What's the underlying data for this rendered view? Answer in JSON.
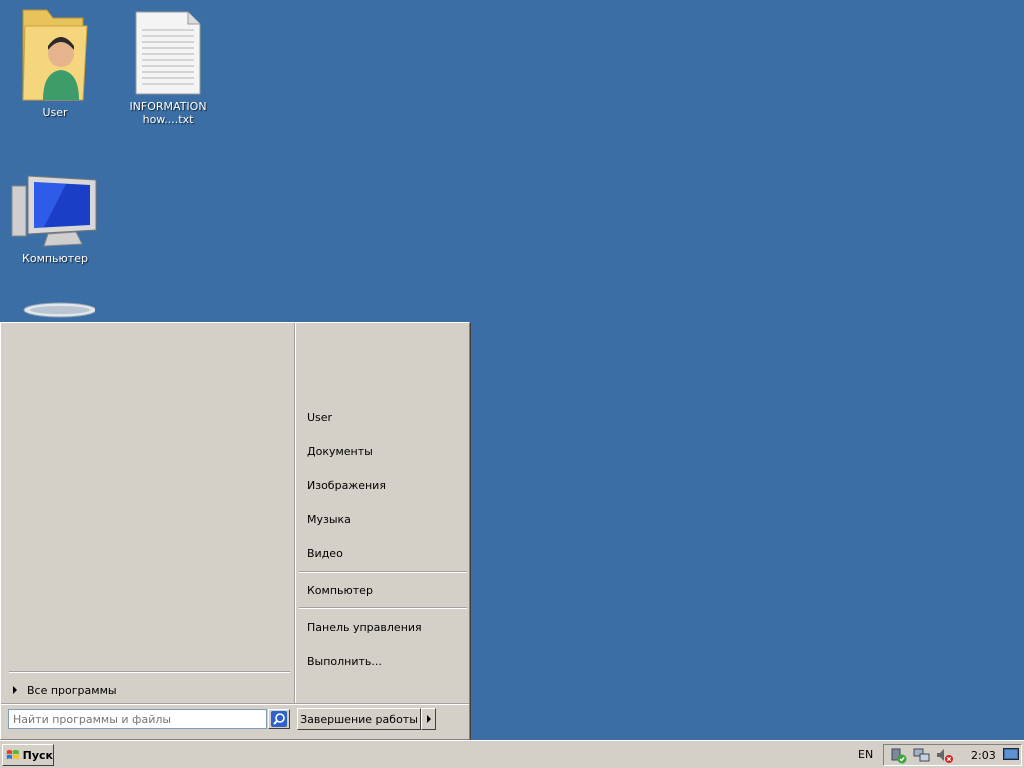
{
  "desktop": {
    "icons": [
      {
        "label": "User"
      },
      {
        "label": "INFORMATION\nhow....txt"
      },
      {
        "label": "Компьютер"
      },
      {
        "label": ""
      }
    ]
  },
  "start_menu": {
    "all_programs": "Все программы",
    "right_items": [
      "User",
      "Документы",
      "Изображения",
      "Музыка",
      "Видео",
      "Компьютер",
      "Панель управления",
      "Выполнить..."
    ],
    "search_placeholder": "Найти программы и файлы",
    "shutdown_label": "Завершение работы"
  },
  "taskbar": {
    "start_label": "Пуск",
    "language": "EN",
    "clock": "2:03"
  },
  "colors": {
    "desktop": "#3a6ea5",
    "panel": "#d4d0c8"
  }
}
